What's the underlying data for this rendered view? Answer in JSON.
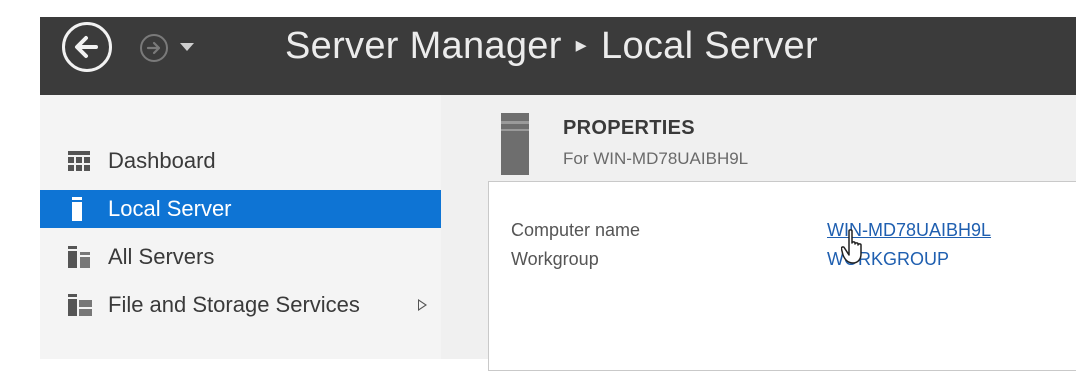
{
  "window": {
    "title": "Server Manager",
    "separator": "▸",
    "page": "Local Server"
  },
  "sidebar": {
    "items": [
      {
        "label": "Dashboard",
        "icon": "dashboard-grid-icon"
      },
      {
        "label": "Local Server",
        "icon": "server-icon",
        "active": true
      },
      {
        "label": "All Servers",
        "icon": "servers-icon"
      },
      {
        "label": "File and Storage Services",
        "icon": "storage-icon",
        "has_submenu": true
      }
    ]
  },
  "properties": {
    "title": "PROPERTIES",
    "subtitle": "For WIN-MD78UAIBH9L",
    "rows": [
      {
        "label": "Computer name",
        "value": "WIN-MD78UAIBH9L"
      },
      {
        "label": "Workgroup",
        "value": "WORKGROUP"
      }
    ]
  },
  "colors": {
    "titlebar": "#3b3b3b",
    "active_nav": "#0e74d4",
    "link": "#1f5fb0"
  }
}
